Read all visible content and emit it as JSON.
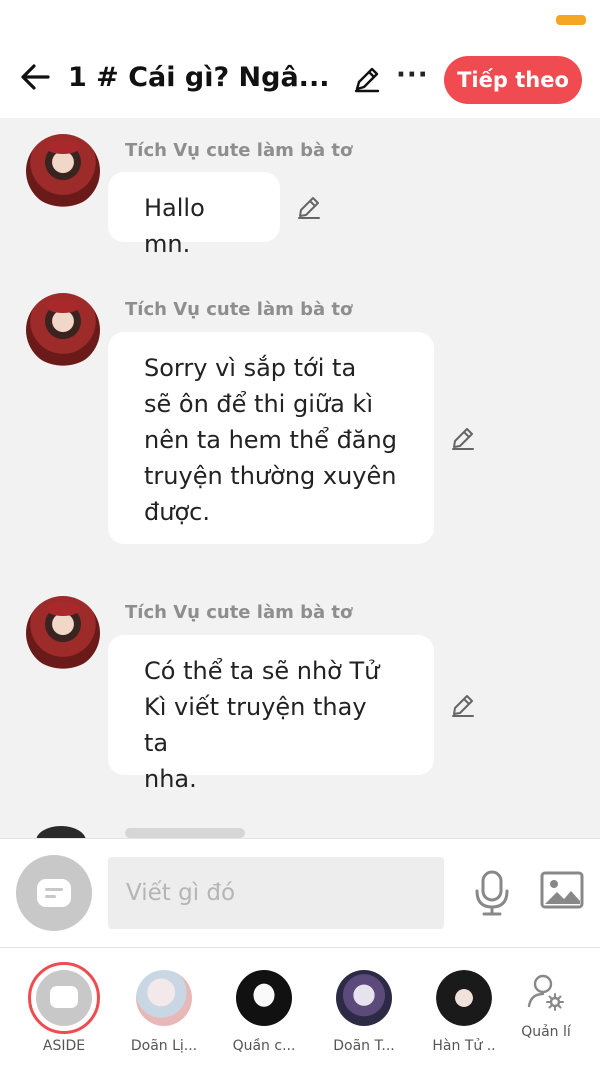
{
  "header": {
    "title": "1 # Cái gì? Ngâ...",
    "more": "···",
    "next_label": "Tiếp theo"
  },
  "messages": [
    {
      "sender": "Tích Vụ cute làm bà tơ",
      "lines": [
        "Hallo mn."
      ]
    },
    {
      "sender": "Tích Vụ cute làm bà tơ",
      "lines": [
        "Sorry vì sắp tới ta",
        "sẽ ôn để thi giữa kì",
        "nên ta hem thể đăng",
        "truyện thường xuyên",
        "được."
      ]
    },
    {
      "sender": "Tích Vụ cute làm bà tơ",
      "lines": [
        "Có thể ta sẽ nhờ Tử",
        "Kì viết truyện thay ta",
        "nha."
      ]
    }
  ],
  "composer": {
    "placeholder": "Viết gì đó"
  },
  "bottom_nav": [
    {
      "label": "ASIDE",
      "active": true
    },
    {
      "label": "Doãn Lị...",
      "active": false
    },
    {
      "label": "Quần c...",
      "active": false
    },
    {
      "label": "Doãn T...",
      "active": false
    },
    {
      "label": "Hàn Tử ..",
      "active": false
    },
    {
      "label": "Quản lí",
      "active": false
    }
  ],
  "colors": {
    "accent": "#f04b50",
    "battery": "#f5a623",
    "background": "#f2f2f2"
  }
}
